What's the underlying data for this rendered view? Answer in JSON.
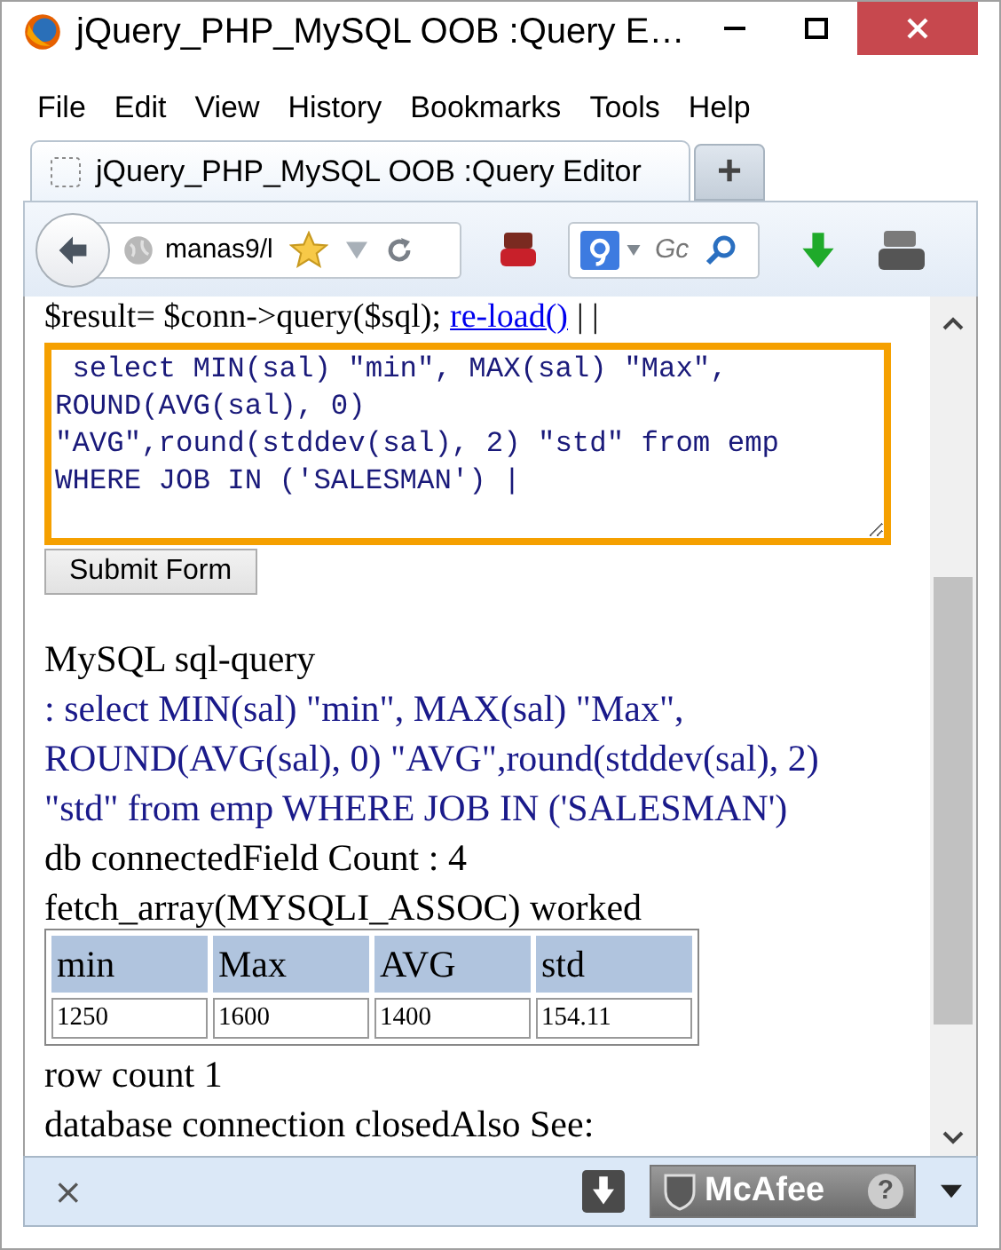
{
  "window": {
    "title": "jQuery_PHP_MySQL OOB :Query E…"
  },
  "menu": [
    {
      "label": "File"
    },
    {
      "label": "Edit"
    },
    {
      "label": "View"
    },
    {
      "label": "History"
    },
    {
      "label": "Bookmarks"
    },
    {
      "label": "Tools"
    },
    {
      "label": "Help"
    }
  ],
  "tabs": [
    {
      "label": "jQuery_PHP_MySQL OOB :Query Editor",
      "selected": true
    }
  ],
  "new_tab": "+",
  "toolbar": {
    "url": "manas9/l",
    "search_placeholder": "Gc"
  },
  "page": {
    "code_line": {
      "text": "$result= $conn->query($sql);",
      "link": "re-load()",
      "suffix": "| |"
    },
    "query_field": {
      "value": " select MIN(sal) \"min\", MAX(sal) \"Max\",\nROUND(AVG(sal), 0)\n\"AVG\",round(stddev(sal), 2) \"std\" from emp\nWHERE JOB IN ('SALESMAN') |"
    },
    "submit_button": "Submit Form",
    "output": [
      {
        "kind": "plain",
        "text": "MySQL sql-query"
      },
      {
        "kind": "query",
        "text": ": select MIN(sal) \"min\", MAX(sal) \"Max\", ROUND(AVG(sal), 0) \"AVG\",round(stddev(sal), 2) \"std\" from emp WHERE JOB IN ('SALESMAN')"
      },
      {
        "kind": "plain",
        "text": "db connectedField Count : 4"
      },
      {
        "kind": "plain",
        "text": "fetch_array(MYSQLI_ASSOC) worked"
      }
    ],
    "table": {
      "columns": [
        "min",
        "Max",
        "AVG",
        "std"
      ],
      "rows": [
        [
          "1250",
          "1600",
          "1400",
          "154.11"
        ]
      ]
    },
    "after": [
      {
        "kind": "plain",
        "text": "row count 1"
      },
      {
        "kind": "plain",
        "text": "database connection closedAlso See:"
      }
    ]
  },
  "status_bar": {
    "close": "×",
    "addon": "McAfee",
    "help": "?"
  }
}
